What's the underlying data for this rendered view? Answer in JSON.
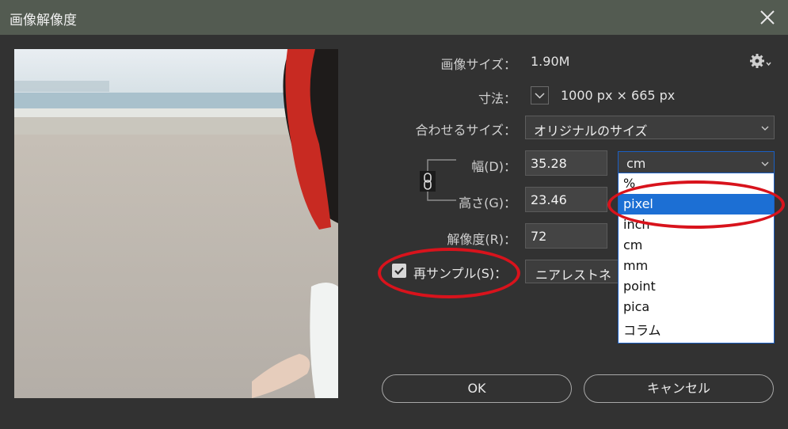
{
  "window": {
    "title": "画像解像度"
  },
  "image_size": {
    "label": "画像サイズ：",
    "value": "1.90M"
  },
  "dimensions": {
    "label": "寸法：",
    "value": "1000 px × 665 px"
  },
  "fit_to": {
    "label": "合わせるサイズ：",
    "value": "オリジナルのサイズ"
  },
  "width": {
    "label": "幅(D)：",
    "value": "35.28",
    "unit": "cm"
  },
  "height": {
    "label": "高さ(G)：",
    "value": "23.46"
  },
  "resolution": {
    "label": "解像度(R)：",
    "value": "72"
  },
  "resample": {
    "label": "再サンプル(S)：",
    "checked": true,
    "method": "ニアレストネイ"
  },
  "unit_menu": {
    "options": [
      "%",
      "pixel",
      "inch",
      "cm",
      "mm",
      "point",
      "pica",
      "コラム"
    ],
    "selected": "pixel"
  },
  "buttons": {
    "ok": "OK",
    "cancel": "キャンセル"
  },
  "icons": {
    "close": "close-icon",
    "gear": "gear-icon",
    "link": "chain-link-icon",
    "chevron": "chevron-down-icon",
    "checkmark": "checkmark-icon"
  },
  "colors": {
    "titlebar": "#535b51",
    "background": "#323232",
    "highlight": "#1c6fd4",
    "annotation": "#d8131c"
  }
}
